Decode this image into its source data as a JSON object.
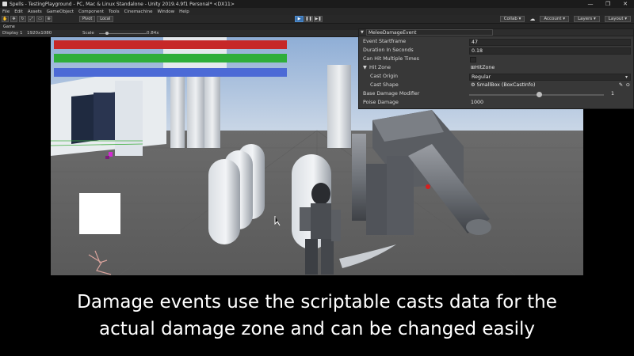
{
  "window": {
    "title": "Spells - TestingPlayground - PC, Mac & Linux Standalone - Unity 2019.4.9f1 Personal* <DX11>",
    "controls": [
      "—",
      "❐",
      "✕"
    ]
  },
  "menu": [
    "File",
    "Edit",
    "Assets",
    "GameObject",
    "Component",
    "Tools",
    "Cinemachine",
    "Window",
    "Help"
  ],
  "toolbar": {
    "pivot_label": "Pivot",
    "local_label": "Local",
    "play_label": "▶",
    "pause_label": "❚❚",
    "step_label": "▶❚",
    "collab_label": "Collab ▾",
    "account_label": "Account ▾",
    "layers_label": "Layers ▾",
    "layout_label": "Layout ▾"
  },
  "game_view": {
    "tab_label": "Game",
    "display_label": "Display 1",
    "resolution_label": "1920x1080",
    "scale_label": "Scale",
    "scale_value": "0.84x"
  },
  "health_bars": {
    "colors": [
      "#c62828",
      "#2fae3a",
      "#4c6ad6"
    ]
  },
  "inspector": {
    "header": "MeleeDamageEvent",
    "rows": [
      {
        "label": "Event Startframe",
        "value": "47"
      },
      {
        "label": "Duration In Seconds",
        "value": "0.18"
      },
      {
        "label": "Can Hit Multiple Times",
        "value": ""
      },
      {
        "label": "Hit Zone",
        "value": "HitZone"
      },
      {
        "label": "Cast Origin",
        "value": "Regular"
      },
      {
        "label": "Cast Shape",
        "value": "SmallBox (BoxCastInfo)"
      },
      {
        "label": "Base Damage Modifier",
        "value": "1"
      },
      {
        "label": "Poise Damage",
        "value": "1000"
      }
    ]
  },
  "caption": {
    "line1": "Damage events use the scriptable casts data for the",
    "line2": "actual damage zone and can be changed easily"
  }
}
